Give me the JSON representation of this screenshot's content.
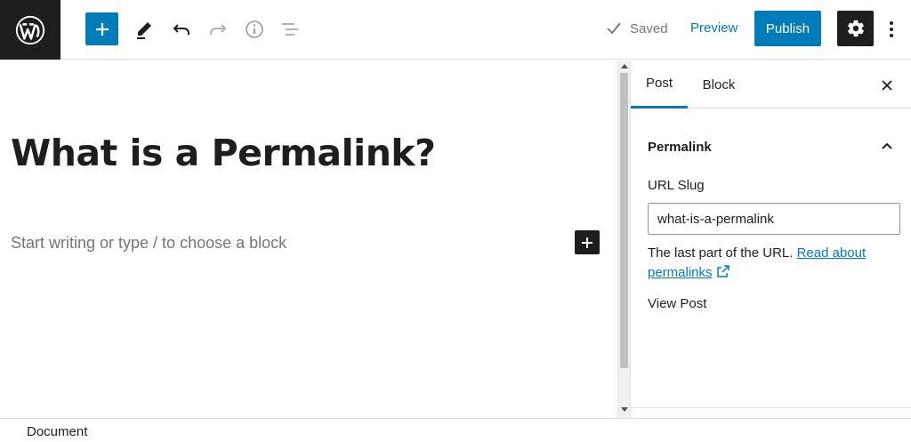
{
  "toolbar": {
    "icons": {
      "logo": "wordpress-icon",
      "add": "plus-icon",
      "tools": "pencil-icon",
      "undo": "undo-icon",
      "redo": "redo-icon",
      "details": "info-icon",
      "outline": "list-view-icon",
      "settings": "gear-icon",
      "more": "more-vertical-icon"
    },
    "saved_label": "Saved",
    "preview_label": "Preview",
    "publish_label": "Publish"
  },
  "editor": {
    "title": "What is a Permalink?",
    "placeholder": "Start writing or type / to choose a block"
  },
  "sidebar": {
    "tabs": [
      {
        "label": "Post",
        "active": true
      },
      {
        "label": "Block",
        "active": false
      }
    ],
    "panel": {
      "title": "Permalink",
      "expanded": true,
      "slug_label": "URL Slug",
      "slug_value": "what-is-a-permalink",
      "help_text": "The last part of the URL.",
      "help_link": "Read about permalinks",
      "view_post": "View Post"
    }
  },
  "footer": {
    "breadcrumb": "Document"
  },
  "colors": {
    "accent": "#007cba",
    "dark": "#1e1e1e",
    "muted": "#757575"
  }
}
